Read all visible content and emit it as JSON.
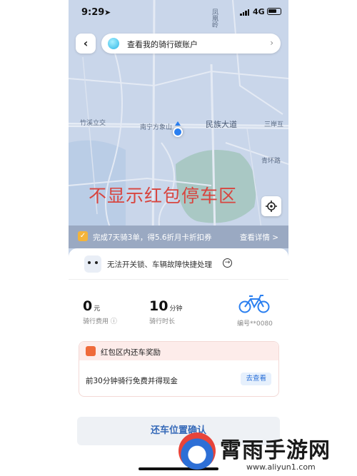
{
  "status_bar": {
    "time": "9:29",
    "network": "4G"
  },
  "top": {
    "carbon_account_text": "查看我的骑行碳账户"
  },
  "map": {
    "labels": [
      "凤凰岭",
      "竹溪立交",
      "南宁方象山",
      "民族大道",
      "三岸互",
      "青环路"
    ],
    "overlay_text": "不显示红包停车区"
  },
  "promo": {
    "text": "完成7天骑3单，得5.6折月卡折扣券",
    "link": "查看详情 >"
  },
  "fault": {
    "text": "无法开关锁、车辆故障快捷处理"
  },
  "ride": {
    "fee_value": "0",
    "fee_unit": "元",
    "fee_label": "骑行费用 ⓘ",
    "time_value": "10",
    "time_unit": "分钟",
    "time_label": "骑行时长",
    "bike_number": "编号**0080"
  },
  "reward": {
    "title": "红包区内还车奖励",
    "body": "前30分钟骑行免费并得现金",
    "button": "去查看"
  },
  "confirm_button": "还车位置确认",
  "watermark": {
    "name": "霄雨手游网",
    "url": "www.aliyun1.com"
  },
  "colors": {
    "map_bg": "#c9d6ea",
    "accent_blue": "#2a7ff0",
    "red_text": "#d8453f"
  }
}
